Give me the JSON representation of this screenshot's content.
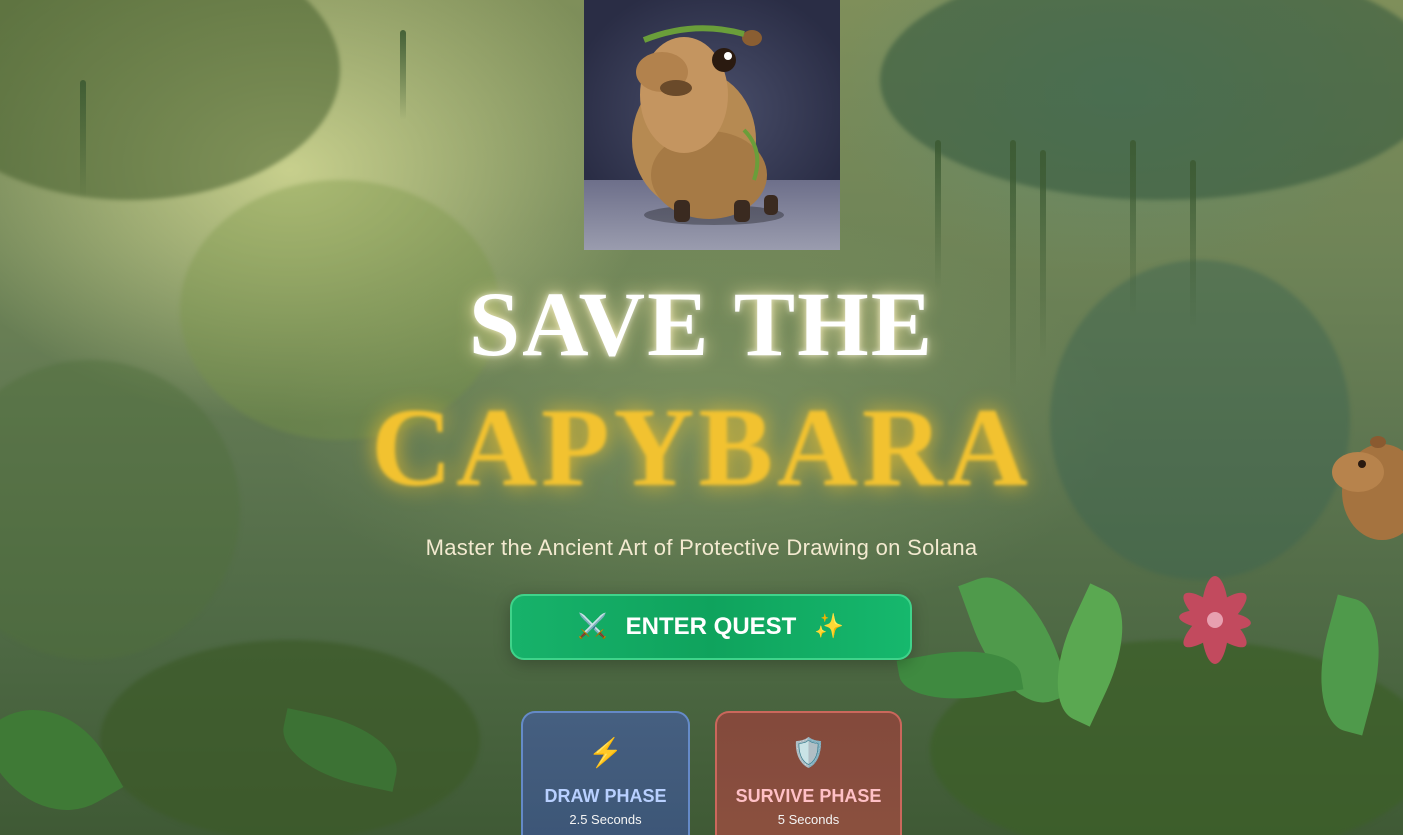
{
  "hero": {
    "title_line_1": "SAVE THE",
    "title_line_2": "CAPYBARA",
    "subtitle": "Master the Ancient Art of Protective Drawing on Solana"
  },
  "cta": {
    "label": "ENTER QUEST",
    "icon_left": "⚔️",
    "icon_right": "✨",
    "color": "#17b26a"
  },
  "phases": [
    {
      "icon": "⚡",
      "icon_name": "lightning-icon",
      "title": "DRAW PHASE",
      "duration": "2.5 Seconds",
      "color": "#b8d0ff"
    },
    {
      "icon": "🛡️",
      "icon_name": "shield-icon",
      "title": "SURVIVE PHASE",
      "duration": "5 Seconds",
      "color": "#ffc0c6"
    }
  ],
  "colors": {
    "title_white": "#ffffff",
    "title_gold": "#f2c230"
  }
}
